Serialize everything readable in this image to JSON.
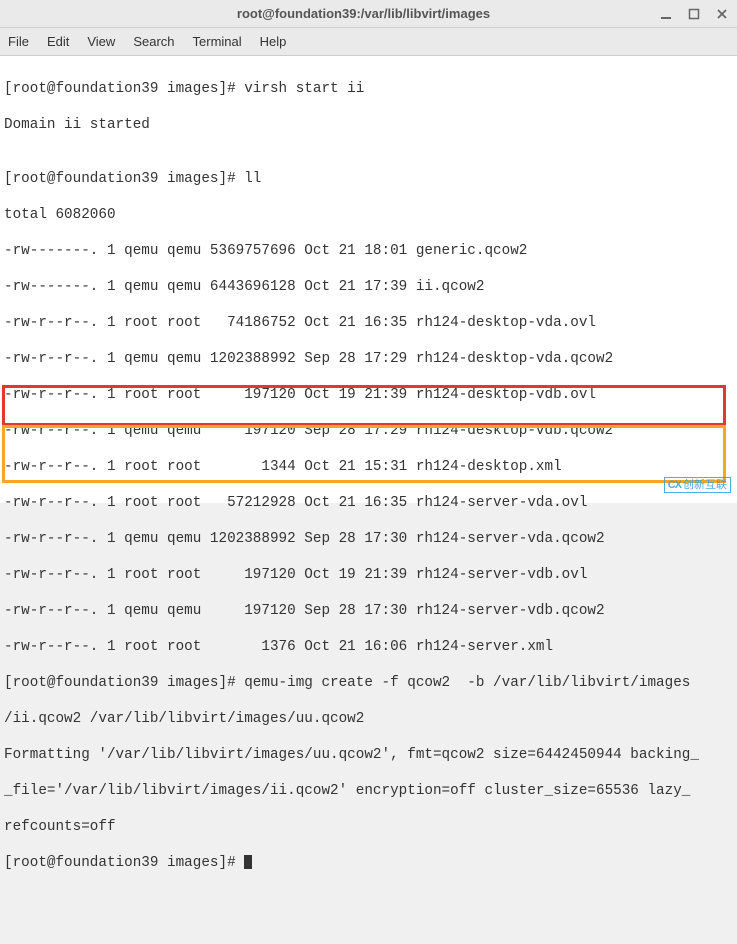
{
  "window": {
    "title": "root@foundation39:/var/lib/libvirt/images"
  },
  "menu": {
    "file": "File",
    "edit": "Edit",
    "view": "View",
    "search": "Search",
    "terminal": "Terminal",
    "help": "Help"
  },
  "term": {
    "l1": "[root@foundation39 images]# virsh start ii",
    "l2": "Domain ii started",
    "l3": "",
    "l4": "[root@foundation39 images]# ll",
    "l5": "total 6082060",
    "l6": "-rw-------. 1 qemu qemu 5369757696 Oct 21 18:01 generic.qcow2",
    "l7": "-rw-------. 1 qemu qemu 6443696128 Oct 21 17:39 ii.qcow2",
    "l8": "-rw-r--r--. 1 root root   74186752 Oct 21 16:35 rh124-desktop-vda.ovl",
    "l9": "-rw-r--r--. 1 qemu qemu 1202388992 Sep 28 17:29 rh124-desktop-vda.qcow2",
    "l10": "-rw-r--r--. 1 root root     197120 Oct 19 21:39 rh124-desktop-vdb.ovl",
    "l11": "-rw-r--r--. 1 qemu qemu     197120 Sep 28 17:29 rh124-desktop-vdb.qcow2",
    "l12": "-rw-r--r--. 1 root root       1344 Oct 21 15:31 rh124-desktop.xml",
    "l13": "-rw-r--r--. 1 root root   57212928 Oct 21 16:35 rh124-server-vda.ovl",
    "l14": "-rw-r--r--. 1 qemu qemu 1202388992 Sep 28 17:30 rh124-server-vda.qcow2",
    "l15": "-rw-r--r--. 1 root root     197120 Oct 19 21:39 rh124-server-vdb.ovl",
    "l16": "-rw-r--r--. 1 qemu qemu     197120 Sep 28 17:30 rh124-server-vdb.qcow2",
    "l17": "-rw-r--r--. 1 root root       1376 Oct 21 16:06 rh124-server.xml",
    "l18": "[root@foundation39 images]# qemu-img create -f qcow2  -b /var/lib/libvirt/images",
    "l19": "/ii.qcow2 /var/lib/libvirt/images/uu.qcow2",
    "l20": "Formatting '/var/lib/libvirt/images/uu.qcow2', fmt=qcow2 size=6442450944 backing_",
    "l21": "_file='/var/lib/libvirt/images/ii.qcow2' encryption=off cluster_size=65536 lazy_",
    "l22": "refcounts=off",
    "l23": "[root@foundation39 images]# "
  },
  "watermark": {
    "text": "创新互联"
  }
}
